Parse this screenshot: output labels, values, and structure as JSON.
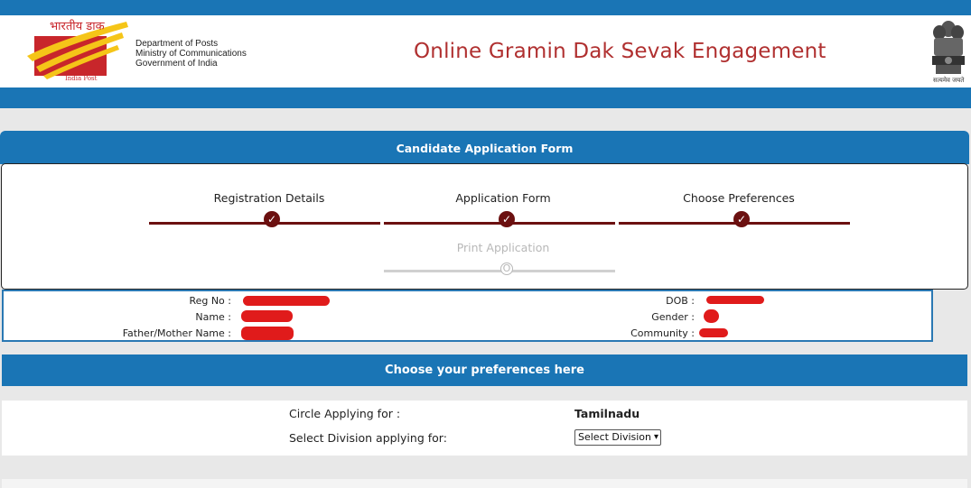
{
  "header": {
    "logo_hindi": "भारतीय डाक",
    "logo_sub": "India Post",
    "dept_lines": [
      "Department of Posts",
      "Ministry of Communications",
      "Government of India"
    ],
    "title": "Online Gramin Dak Sevak Engagement",
    "emblem_text": "सत्यमेव जयते"
  },
  "form": {
    "header": "Candidate Application Form",
    "steps": [
      {
        "label": "Registration Details",
        "status": "complete",
        "icon": "check-icon"
      },
      {
        "label": "Application Form",
        "status": "complete",
        "icon": "check-icon"
      },
      {
        "label": "Choose Preferences",
        "status": "complete",
        "icon": "check-icon"
      },
      {
        "label": "Print Application",
        "status": "pending",
        "icon": "circle-icon"
      }
    ],
    "check_glyph": "✓",
    "pending_glyph": "O"
  },
  "candidate": {
    "reg_no_label": "Reg No :",
    "name_label": "Name :",
    "parent_label": "Father/Mother Name :",
    "dob_label": "DOB :",
    "gender_label": "Gender :",
    "community_label": "Community :"
  },
  "preferences": {
    "header": "Choose your preferences here",
    "circle_label": "Circle Applying for :",
    "circle_value": "Tamilnadu",
    "division_label": "Select Division applying for:",
    "division_selected": "Select Division",
    "arrow_glyph": "▾"
  },
  "colors": {
    "brand_blue": "#1a75b5",
    "title_red": "#b03030",
    "step_maroon": "#6b1010",
    "redaction": "#e01b1b"
  }
}
